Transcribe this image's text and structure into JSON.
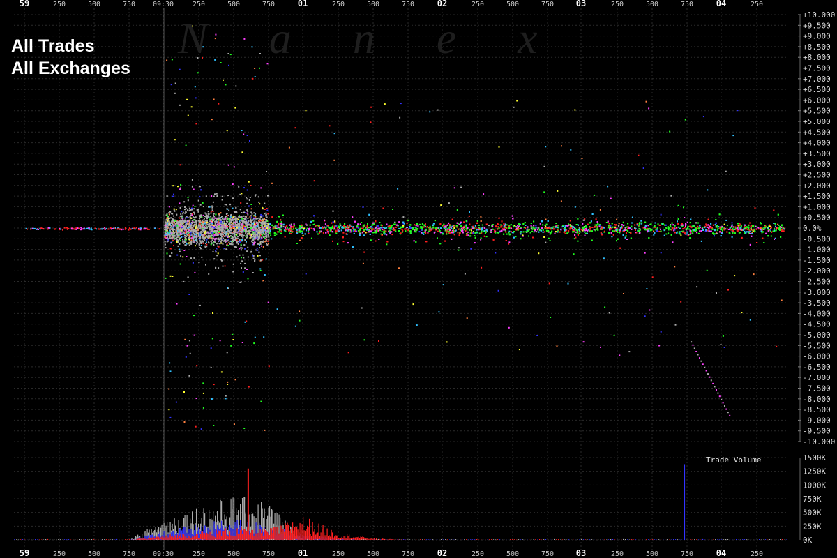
{
  "header": {
    "title_line1": "All Trades",
    "title_line2": "All Exchanges",
    "watermark": "Nanex"
  },
  "chart_data": [
    {
      "type": "scatter",
      "title": "All Trades All Exchanges",
      "xlabel": "",
      "ylabel": "",
      "ylim": [
        -10,
        10
      ],
      "y_tick_labels": [
        "+10.000",
        "+9.500",
        "+9.000",
        "+8.500",
        "+8.000",
        "+7.500",
        "+7.000",
        "+6.500",
        "+6.000",
        "+5.500",
        "+5.000",
        "+4.500",
        "+4.000",
        "+3.500",
        "+3.000",
        "+2.500",
        "+2.000",
        "+1.500",
        "+1.000",
        "+0.500",
        "0.0%",
        "-0.500",
        "-1.000",
        "-1.500",
        "-2.000",
        "-2.500",
        "-3.000",
        "-3.500",
        "-4.000",
        "-4.500",
        "-5.000",
        "-5.500",
        "-6.000",
        "-6.500",
        "-7.000",
        "-7.500",
        "-8.000",
        "-8.500",
        "-9.000",
        "-9.500",
        "-10.000"
      ],
      "x_tick_labels": [
        {
          "label": "59",
          "major": true
        },
        {
          "label": "250",
          "major": false
        },
        {
          "label": "500",
          "major": false
        },
        {
          "label": "750",
          "major": false
        },
        {
          "label": "09:30",
          "major": false
        },
        {
          "label": "250",
          "major": false
        },
        {
          "label": "500",
          "major": false
        },
        {
          "label": "750",
          "major": false
        },
        {
          "label": "01",
          "major": true
        },
        {
          "label": "250",
          "major": false
        },
        {
          "label": "500",
          "major": false
        },
        {
          "label": "750",
          "major": false
        },
        {
          "label": "02",
          "major": true
        },
        {
          "label": "250",
          "major": false
        },
        {
          "label": "500",
          "major": false
        },
        {
          "label": "750",
          "major": false
        },
        {
          "label": "03",
          "major": true
        },
        {
          "label": "250",
          "major": false
        },
        {
          "label": "500",
          "major": false
        },
        {
          "label": "750",
          "major": false
        },
        {
          "label": "04",
          "major": true
        },
        {
          "label": "250",
          "major": false
        }
      ],
      "x_range_seconds": [
        -1,
        4.45
      ],
      "open_time_seconds": 0,
      "grid": true,
      "series_colors": [
        "#aaaaaa",
        "#ff2020",
        "#3333ff",
        "#20ff20",
        "#ff40ff",
        "#30c0ff",
        "#ffff30",
        "#ff8040"
      ]
    },
    {
      "type": "bar",
      "title": "Trade Volume",
      "ylim": [
        0,
        1500
      ],
      "y_tick_labels": [
        "1500K",
        "1250K",
        "1000K",
        "750K",
        "500K",
        "250K",
        "0K"
      ],
      "series": [
        {
          "color": "#aaaaaa",
          "values": [
            0,
            0,
            0,
            0,
            260,
            420,
            540,
            480,
            0,
            0,
            0,
            0,
            0,
            0,
            0,
            0,
            0,
            0,
            0,
            0,
            0,
            0
          ]
        },
        {
          "color": "#3333ff",
          "values": [
            0,
            0,
            0,
            0,
            120,
            200,
            260,
            200,
            70,
            10,
            0,
            0,
            0,
            0,
            0,
            0,
            0,
            0,
            1380,
            0,
            0,
            0
          ]
        },
        {
          "color": "#ff2020",
          "values": [
            0,
            0,
            0,
            0,
            60,
            100,
            160,
            140,
            300,
            90,
            20,
            0,
            0,
            0,
            0,
            0,
            0,
            0,
            0,
            0,
            0,
            0
          ]
        }
      ],
      "peak_values": [
        {
          "x_seconds": 0.6,
          "value": 1300
        },
        {
          "x_seconds": 3.73,
          "value": 1380
        }
      ]
    }
  ]
}
